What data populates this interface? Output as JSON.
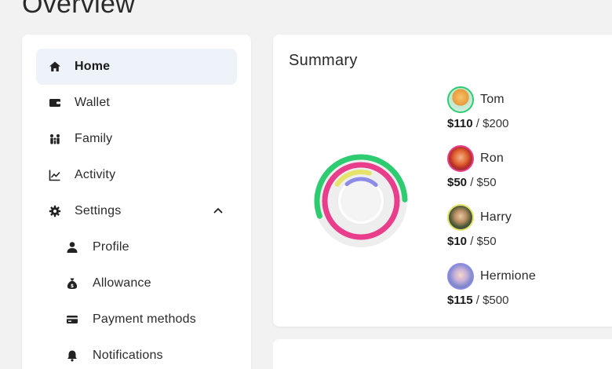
{
  "page": {
    "title": "Overview"
  },
  "sidebar": {
    "items": [
      {
        "label": "Home",
        "icon": "home-icon",
        "active": true
      },
      {
        "label": "Wallet",
        "icon": "wallet-icon"
      },
      {
        "label": "Family",
        "icon": "family-icon"
      },
      {
        "label": "Activity",
        "icon": "chart-icon"
      },
      {
        "label": "Settings",
        "icon": "gear-icon",
        "expanded": true
      },
      {
        "label": "Profile",
        "icon": "person-icon",
        "sub": true
      },
      {
        "label": "Allowance",
        "icon": "money-bag-icon",
        "sub": true
      },
      {
        "label": "Payment methods",
        "icon": "credit-card-icon",
        "sub": true
      },
      {
        "label": "Notifications",
        "icon": "bell-icon",
        "sub": true
      }
    ]
  },
  "summary": {
    "title": "Summary",
    "members": [
      {
        "name": "Tom",
        "spent": "$110",
        "limit": "$200",
        "sep": " / ",
        "color": "#2ecc71",
        "progress": 0.55
      },
      {
        "name": "Ron",
        "spent": "$50",
        "limit": "$50",
        "sep": " / ",
        "color": "#e83e8c",
        "progress": 1.0
      },
      {
        "name": "Harry",
        "spent": "$10",
        "limit": "$50",
        "sep": " / ",
        "color": "#e6e36a",
        "progress": 0.2
      },
      {
        "name": "Hermione",
        "spent": "$115",
        "limit": "$500",
        "sep": " / ",
        "color": "#8c8ce6",
        "progress": 0.23
      }
    ]
  },
  "colors": {
    "accent_bg": "#eef3f9",
    "ring_track": "#eeeeee"
  }
}
